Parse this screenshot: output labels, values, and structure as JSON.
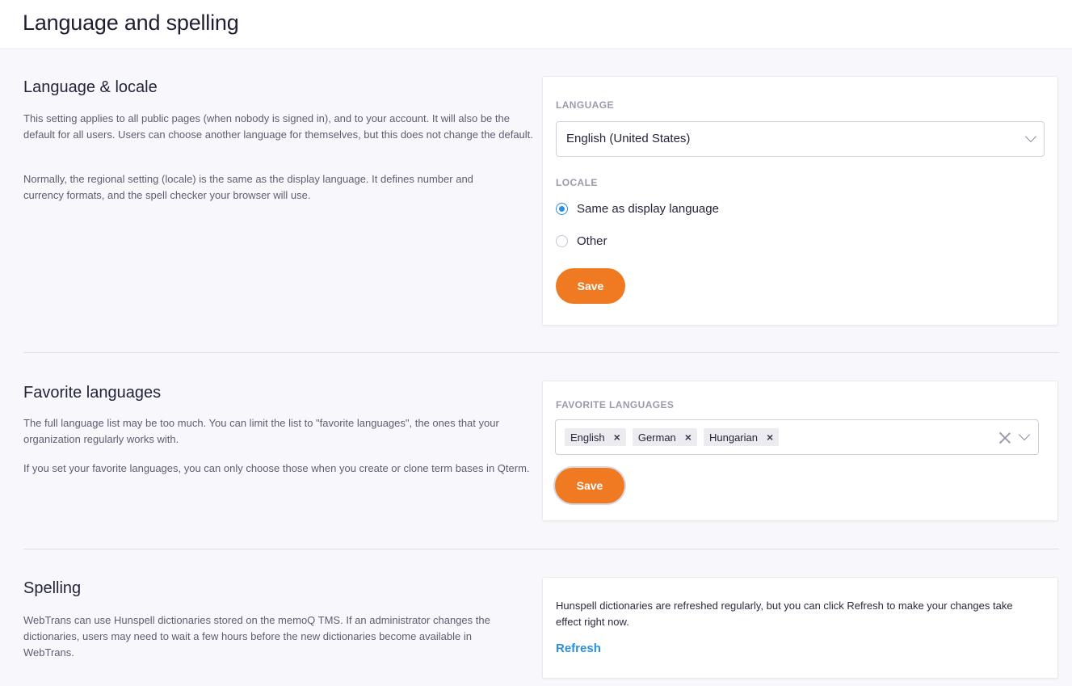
{
  "page": {
    "title": "Language and spelling"
  },
  "language_locale": {
    "title": "Language & locale",
    "desc1": "This setting applies to all public pages (when nobody is signed in), and to your account. It will also be the default for all users. Users can choose another language for themselves, but this does not change the default.",
    "desc2": "Normally, the regional setting (locale) is the same as the display language. It defines number and currency formats, and the spell checker your browser will use.",
    "language_label": "LANGUAGE",
    "language_value": "English (United States)",
    "locale_label": "LOCALE",
    "locale_options": [
      "Same as display language",
      "Other"
    ],
    "locale_selected": "Same as display language",
    "save_label": "Save"
  },
  "favorites": {
    "title": "Favorite languages",
    "desc1": "The full language list may be too much. You can limit the list to \"favorite languages\", the ones that your organization regularly works with.",
    "desc2": "If you set your favorite languages, you can only choose those when you create or clone term bases in Qterm.",
    "field_label": "FAVORITE LANGUAGES",
    "chips": [
      "English",
      "German",
      "Hungarian"
    ],
    "chip_remove": "×",
    "save_label": "Save"
  },
  "spelling": {
    "title": "Spelling",
    "desc": "WebTrans can use Hunspell dictionaries stored on the memoQ TMS. If an administrator changes the dictionaries, users may need to wait a few hours before the new dictionaries become available in WebTrans.",
    "card_text": "Hunspell dictionaries are refreshed regularly, but you can click Refresh to make your changes take effect right now.",
    "refresh_label": "Refresh"
  },
  "colors": {
    "accent": "#f07a22",
    "link": "#2b8fe0"
  },
  "icons": {
    "dropdown": "chevron-down-icon",
    "clear": "clear-icon",
    "remove": "remove-chip-icon"
  }
}
